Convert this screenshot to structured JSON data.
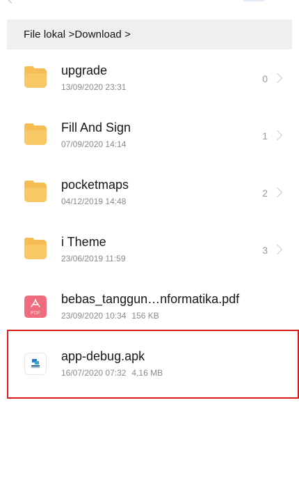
{
  "breadcrumb": {
    "path": "File lokal >Download >"
  },
  "items": [
    {
      "name": "upgrade",
      "date": "13/09/2020 23:31",
      "count": "0",
      "type": "folder"
    },
    {
      "name": "Fill And Sign",
      "date": "07/09/2020 14:14",
      "count": "1",
      "type": "folder"
    },
    {
      "name": "pocketmaps",
      "date": "04/12/2019 14:48",
      "count": "2",
      "type": "folder"
    },
    {
      "name": "i Theme",
      "date": "23/06/2019 11:59",
      "count": "3",
      "type": "folder"
    },
    {
      "name": "bebas_tanggun…nformatika.pdf",
      "date": "23/09/2020 10:34",
      "size": "156 KB",
      "type": "pdf",
      "icon_label": "PDF"
    },
    {
      "name": "app-debug.apk",
      "date": "16/07/2020 07:32",
      "size": "4,16 MB",
      "type": "apk",
      "highlighted": true
    }
  ],
  "colors": {
    "folder": "#f6bd55",
    "pdf": "#ef6b7e",
    "highlight_border": "#d81b1b",
    "breadcrumb_bg": "#efefef"
  },
  "icons": {
    "folder": "folder-icon",
    "pdf": "pdf-file-icon",
    "apk": "apk-file-icon",
    "chevron": "chevron-right-icon"
  }
}
